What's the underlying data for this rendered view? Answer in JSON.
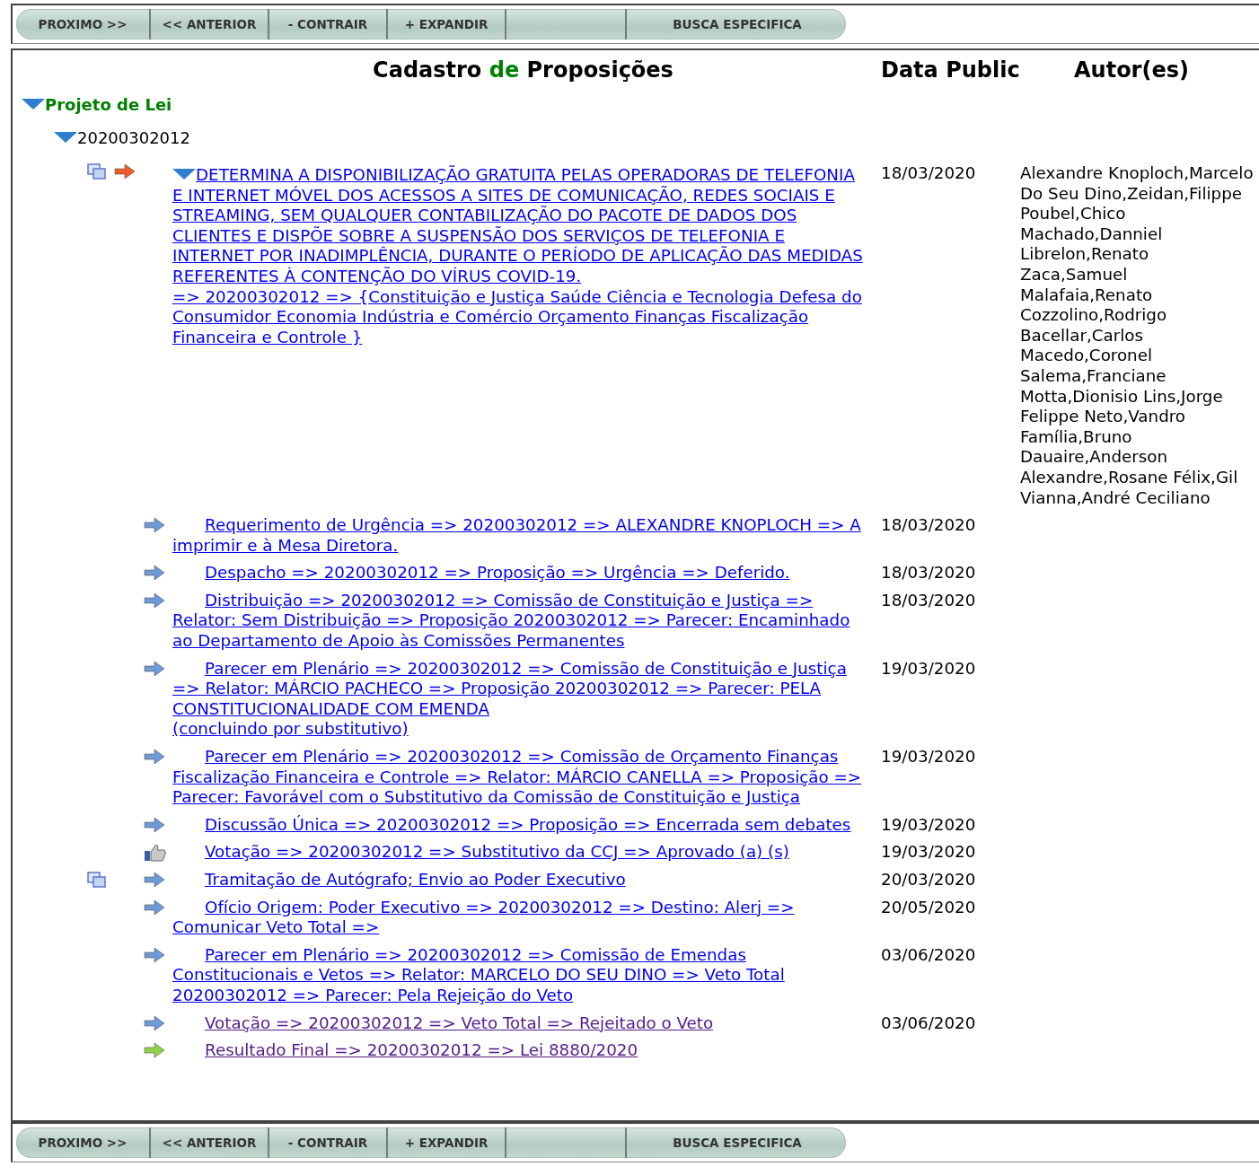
{
  "top_toolbar": {
    "buttons": [
      "PROXIMO >>",
      "<< ANTERIOR",
      "- CONTRAIR",
      "+ EXPANDIR",
      "BUSCA ESPECIFICA"
    ]
  },
  "header": {
    "title_before": "Cadastro",
    "title_highlight": "de",
    "title_after": "Proposições",
    "date_heading": "Data Public",
    "authors_heading": "Autor(es)"
  },
  "tree": {
    "label": "Projeto de Lei",
    "expanded": true,
    "children": [
      {
        "label": "20200302012",
        "expanded": true,
        "proposition": {
          "expanded": true,
          "has_document": true,
          "visited": false,
          "text": "DETERMINA A DISPONIBILIZAÇÃO GRATUITA PELAS OPERADORAS DE TELEFONIA E INTERNET MÓVEL DOS ACESSOS A SITES DE COMUNICAÇÃO, REDES SOCIAIS E STREAMING, SEM QUALQUER CONTABILIZAÇÃO DO PACOTE DE DADOS DOS CLIENTES E DISPÕE SOBRE A SUSPENSÃO DOS SERVIÇOS DE TELEFONIA E INTERNET POR INADIMPLÊNCIA, DURANTE O PERÍODO DE APLICAÇÃO DAS MEDIDAS REFERENTES À CONTENÇÃO DO VÍRUS COVID-19.\n=> 20200302012 => {Constituição e Justiça Saúde Ciência e Tecnologia Defesa do Consumidor Economia Indústria e Comércio Orçamento Finanças Fiscalização Financeira e Controle }",
          "date": "18/03/2020",
          "authors": "Alexandre Knoploch,Marcelo Do Seu Dino,Zeidan,Filippe Poubel,Chico Machado,Danniel Librelon,Renato Zaca,Samuel Malafaia,Renato Cozzolino,Rodrigo Bacellar,Carlos Macedo,Coronel Salema,Franciane Motta,Dionisio Lins,Jorge Felippe Neto,Vandro Família,Bruno Dauaire,Anderson Alexandre,Rosane Félix,Gil Vianna,André Ceciliano"
        },
        "steps": [
          {
            "kind": "action",
            "has_document": false,
            "visited": false,
            "text": "Requerimento de Urgência => 20200302012 => ALEXANDRE KNOPLOCH => A imprimir e à Mesa Diretora.",
            "date": "18/03/2020"
          },
          {
            "kind": "action",
            "has_document": false,
            "visited": false,
            "text": "Despacho => 20200302012 => Proposição => Urgência => Deferido.",
            "date": "18/03/2020"
          },
          {
            "kind": "action",
            "has_document": false,
            "visited": false,
            "text": "Distribuição => 20200302012 => Comissão de Constituição e Justiça => Relator: Sem Distribuição => Proposição 20200302012 => Parecer: Encaminhado ao Departamento de Apoio às Comissões Permanentes",
            "date": "18/03/2020"
          },
          {
            "kind": "action",
            "has_document": false,
            "visited": false,
            "text": "Parecer em Plenário => 20200302012 => Comissão de Constituição e Justiça => Relator: MÁRCIO PACHECO => Proposição 20200302012 => Parecer: PELA CONSTITUCIONALIDADE COM EMENDA\n(concluindo por substitutivo)",
            "date": "19/03/2020"
          },
          {
            "kind": "action",
            "has_document": false,
            "visited": false,
            "text": "Parecer em Plenário => 20200302012 => Comissão de Orçamento Finanças Fiscalização Financeira e Controle => Relator: MÁRCIO CANELLA => Proposição => Parecer: Favorável com o Substitutivo da Comissão de Constituição e Justiça",
            "date": "19/03/2020"
          },
          {
            "kind": "action",
            "has_document": false,
            "visited": false,
            "text": "Discussão Única => 20200302012 => Proposição => Encerrada sem debates",
            "date": "19/03/2020"
          },
          {
            "kind": "vote",
            "has_document": false,
            "visited": false,
            "text": "Votação => 20200302012 => Substitutivo da CCJ => Aprovado (a) (s)",
            "date": "19/03/2020"
          },
          {
            "kind": "action",
            "has_document": true,
            "visited": false,
            "text": "Tramitação de Autógrafo; Envio ao Poder Executivo",
            "date": "20/03/2020"
          },
          {
            "kind": "action",
            "has_document": false,
            "visited": false,
            "text": "Ofício Origem: Poder Executivo => 20200302012 => Destino: Alerj => Comunicar Veto Total =>",
            "date": "20/05/2020"
          },
          {
            "kind": "action",
            "has_document": false,
            "visited": false,
            "text": "Parecer em Plenário => 20200302012 => Comissão de Emendas Constitucionais e Vetos => Relator: MARCELO DO SEU DINO => Veto Total 20200302012 => Parecer: Pela Rejeição do Veto",
            "date": "03/06/2020"
          },
          {
            "kind": "action",
            "has_document": false,
            "visited": true,
            "text": "Votação => 20200302012 => Veto Total => Rejeitado o Veto",
            "date": "03/06/2020"
          },
          {
            "kind": "final",
            "has_document": false,
            "visited": true,
            "text": "Resultado Final => 20200302012 => Lei 8880/2020"
          }
        ]
      }
    ]
  },
  "bottom_toolbar": {
    "buttons": [
      "PROXIMO >>",
      "<< ANTERIOR",
      "- CONTRAIR",
      "+ EXPANDIR",
      "BUSCA ESPECIFICA"
    ]
  }
}
